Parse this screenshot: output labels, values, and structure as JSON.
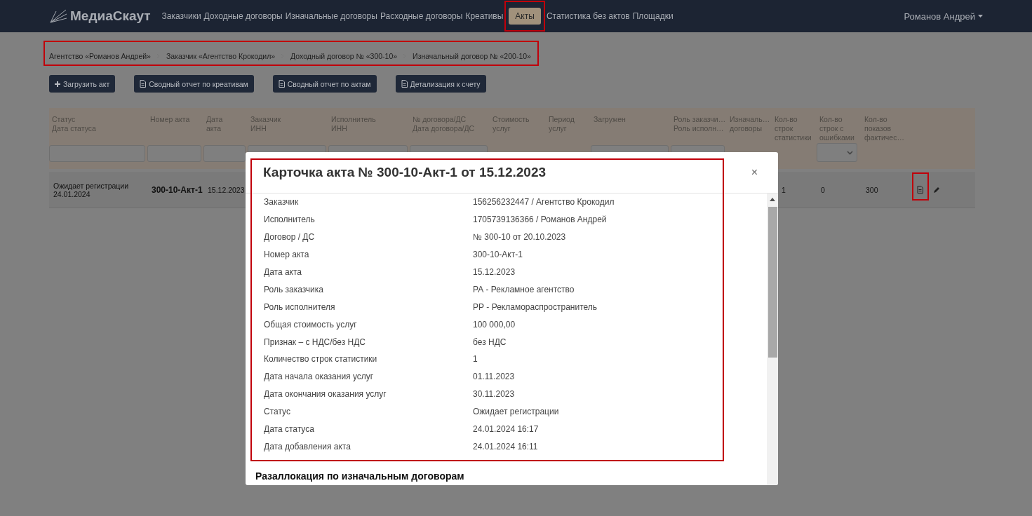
{
  "nav": {
    "logo": "МедиаСкаут",
    "items": [
      {
        "label": "Заказчики",
        "selected": false
      },
      {
        "label": "Доходные договоры",
        "selected": false
      },
      {
        "label": "Изначальные договоры",
        "selected": false
      },
      {
        "label": "Расходные договоры",
        "selected": false
      },
      {
        "label": "Креативы",
        "selected": false
      },
      {
        "label": "Акты",
        "selected": true
      },
      {
        "label": "Статистика без актов",
        "selected": false
      },
      {
        "label": "Площадки",
        "selected": false
      }
    ],
    "user": "Романов Андрей"
  },
  "breadcrumbs": [
    "Агентство «Романов Андрей»",
    "Заказчик «Агентство Крокодил»",
    "Доходный договор № «300-10»",
    "Изначальный договор № «200-10»"
  ],
  "toolbar": [
    {
      "label": "Загрузить акт",
      "kind": "plus"
    },
    {
      "label": "Сводный отчет по креативам",
      "kind": "file"
    },
    {
      "label": "Сводный отчет по актам",
      "kind": "file"
    },
    {
      "label": "Детализация к счету",
      "kind": "file"
    }
  ],
  "table": {
    "columns": [
      {
        "lines": [
          "Статус",
          "Дата статуса"
        ],
        "kind": "text"
      },
      {
        "lines": [
          "Номер акта"
        ],
        "kind": "text"
      },
      {
        "lines": [
          "Дата",
          "акта"
        ],
        "kind": "text"
      },
      {
        "lines": [
          "Заказчик",
          "ИНН"
        ],
        "kind": "text"
      },
      {
        "lines": [
          "Исполнитель",
          "ИНН"
        ],
        "kind": "text"
      },
      {
        "lines": [
          "№ договора/ДС",
          "Дата договора/ДС"
        ],
        "kind": "text"
      },
      {
        "lines": [
          "Стоимость",
          "услуг"
        ],
        "kind": "plain"
      },
      {
        "lines": [
          "Период",
          "услуг"
        ],
        "kind": "plain"
      },
      {
        "lines": [
          "Загружен"
        ],
        "kind": "text"
      },
      {
        "lines": [
          "Роль заказчи…",
          "Роль исполн…"
        ],
        "kind": "text"
      },
      {
        "lines": [
          "Изначаль…",
          "договоры"
        ],
        "kind": "plain"
      },
      {
        "lines": [
          "Кол-во",
          "строк",
          "статистики"
        ],
        "kind": "plain"
      },
      {
        "lines": [
          "Кол-во",
          "строк с",
          "ошибками"
        ],
        "kind": "select"
      },
      {
        "lines": [
          "Кол-во",
          "показов",
          "фактичес…"
        ],
        "kind": "plain"
      }
    ],
    "rows": [
      {
        "status": "Ожидает регистрации",
        "status_date": "24.01.2024",
        "number": "300-10-Акт-1",
        "date": "15.12.2023",
        "statistics_rows": "1",
        "error_rows": "0",
        "impressions": "300"
      }
    ]
  },
  "modal": {
    "title": "Карточка акта № 300-10-Акт-1 от 15.12.2023",
    "close": "×",
    "fields": [
      {
        "label": "Заказчик",
        "value": "156256232447 / Агентство Крокодил"
      },
      {
        "label": "Исполнитель",
        "value": "1705739136366 / Романов Андрей"
      },
      {
        "label": "Договор / ДС",
        "value": "№ 300-10 от 20.10.2023"
      },
      {
        "label": "Номер акта",
        "value": "300-10-Акт-1"
      },
      {
        "label": "Дата акта",
        "value": "15.12.2023"
      },
      {
        "label": "Роль заказчика",
        "value": "РА - Рекламное агентство"
      },
      {
        "label": "Роль исполнителя",
        "value": "РР - Рекламораспространитель"
      },
      {
        "label": "Общая стоимость услуг",
        "value": "100 000,00"
      },
      {
        "label": "Признак – с НДС/без НДС",
        "value": "без НДС"
      },
      {
        "label": "Количество строк статистики",
        "value": "1"
      },
      {
        "label": "Дата начала оказания услуг",
        "value": "01.11.2023"
      },
      {
        "label": "Дата окончания оказания услуг",
        "value": "30.11.2023"
      },
      {
        "label": "Статус",
        "value": "Ожидает регистрации"
      },
      {
        "label": "Дата статуса",
        "value": "24.01.2024 16:17"
      },
      {
        "label": "Дата добавления акта",
        "value": "24.01.2024 16:11"
      }
    ],
    "section_heading": "Разаллокация по изначальным договорам"
  }
}
